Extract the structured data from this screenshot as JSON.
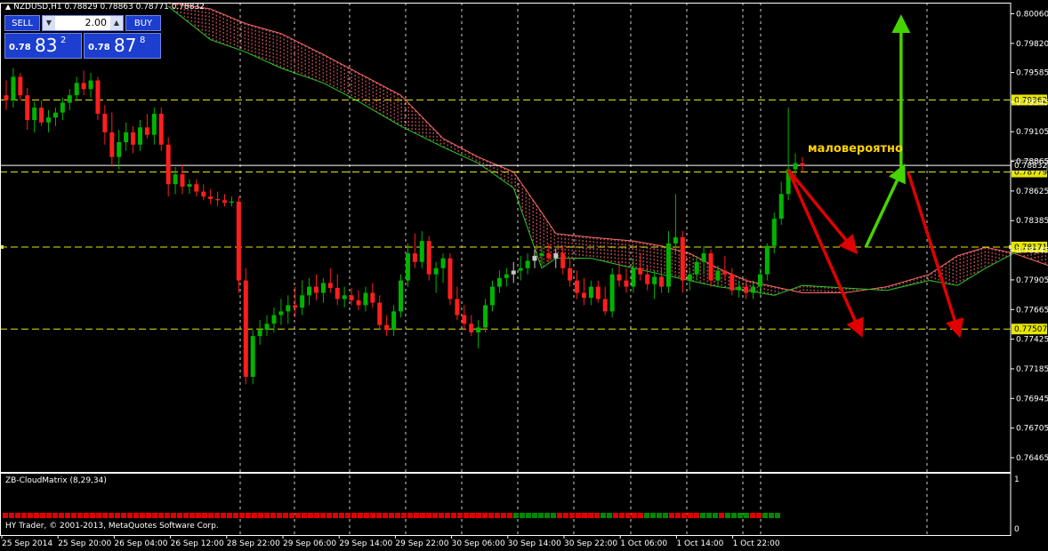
{
  "header": {
    "symbol_label": "NZDUSD,H1",
    "ohlc_text": "0.78829 0.78863 0.78771 0.78832"
  },
  "trade_panel": {
    "sell_label": "SELL",
    "buy_label": "BUY",
    "lot_value": "2.00",
    "sell_quote": {
      "prefix": "0.78",
      "big": "83",
      "sup": "2"
    },
    "buy_quote": {
      "prefix": "0.78",
      "big": "87",
      "sup": "8"
    }
  },
  "annotation_text": "маловероятно",
  "indicator": {
    "label": "ZB-CloudMatrix (8,29,34)",
    "scale_top": "1",
    "scale_bottom": "0"
  },
  "copyright": "HY Trader, © 2001-2013, MetaQuotes Software Corp.",
  "colors": {
    "background": "#000000",
    "bull": "#00b400",
    "bear": "#ff1e1e",
    "neutral": "#c8c8c8",
    "level_line": "#e6e600",
    "cloud_upper": "#ff6a6a",
    "cloud_lower": "#28c828",
    "arrow_red": "#e00000",
    "arrow_green": "#46d400"
  },
  "chart_data": {
    "type": "candlestick",
    "symbol": "NZDUSD",
    "timeframe": "H1",
    "ylim": [
      0.7635,
      0.8015
    ],
    "y_ticks": [
      "0.80060",
      "0.79820",
      "0.79585",
      "0.79345",
      "0.79105",
      "0.78865",
      "0.78625",
      "0.78385",
      "0.78145",
      "0.77905",
      "0.77665",
      "0.77425",
      "0.77185",
      "0.76945",
      "0.76705",
      "0.76465"
    ],
    "x_tick_labels": [
      "25 Sep 2014",
      "25 Sep 20:00",
      "26 Sep 04:00",
      "26 Sep 12:00",
      "28 Sep 22:00",
      "29 Sep 06:00",
      "29 Sep 14:00",
      "29 Sep 22:00",
      "30 Sep 06:00",
      "30 Sep 14:00",
      "30 Sep 22:00",
      "1 Oct 06:00",
      "1 Oct 14:00",
      "1 Oct 22:00"
    ],
    "price_levels": [
      {
        "value": 0.79362,
        "label": "0.79362"
      },
      {
        "value": 0.78779,
        "label": "0.78779"
      },
      {
        "value": 0.78171,
        "label": "0.78171"
      },
      {
        "value": 0.77507,
        "label": "0.77507"
      }
    ],
    "bid_line": {
      "value": 0.78832,
      "label": "0.78832"
    },
    "candles": [
      [
        0.794,
        0.7952,
        0.7928,
        0.7936
      ],
      [
        0.7936,
        0.7962,
        0.793,
        0.7955
      ],
      [
        0.7955,
        0.7958,
        0.7936,
        0.794
      ],
      [
        0.794,
        0.7946,
        0.7912,
        0.792
      ],
      [
        0.792,
        0.7935,
        0.791,
        0.793
      ],
      [
        0.793,
        0.7936,
        0.7915,
        0.7918
      ],
      [
        0.7918,
        0.7928,
        0.791,
        0.7922
      ],
      [
        0.7922,
        0.793,
        0.7915,
        0.7926
      ],
      [
        0.7926,
        0.7938,
        0.792,
        0.7934
      ],
      [
        0.7934,
        0.7945,
        0.7928,
        0.794
      ],
      [
        0.794,
        0.7955,
        0.7935,
        0.795
      ],
      [
        0.795,
        0.796,
        0.794,
        0.7945
      ],
      [
        0.7945,
        0.7958,
        0.7938,
        0.7952
      ],
      [
        0.7952,
        0.7955,
        0.792,
        0.7925
      ],
      [
        0.7925,
        0.7932,
        0.79,
        0.791
      ],
      [
        0.791,
        0.7926,
        0.7882,
        0.789
      ],
      [
        0.789,
        0.7912,
        0.788,
        0.7902
      ],
      [
        0.7902,
        0.7918,
        0.7895,
        0.791
      ],
      [
        0.791,
        0.7915,
        0.7893,
        0.79
      ],
      [
        0.79,
        0.792,
        0.7895,
        0.7914
      ],
      [
        0.7914,
        0.7925,
        0.7905,
        0.7908
      ],
      [
        0.7908,
        0.793,
        0.79,
        0.7925
      ],
      [
        0.7925,
        0.793,
        0.7895,
        0.79
      ],
      [
        0.79,
        0.7906,
        0.7858,
        0.7868
      ],
      [
        0.7868,
        0.7882,
        0.786,
        0.7876
      ],
      [
        0.7876,
        0.7884,
        0.786,
        0.7866
      ],
      [
        0.7866,
        0.7872,
        0.786,
        0.7868
      ],
      [
        0.7868,
        0.7872,
        0.7858,
        0.7862
      ],
      [
        0.7862,
        0.7868,
        0.7855,
        0.7858
      ],
      [
        0.7858,
        0.7864,
        0.7852,
        0.7856
      ],
      [
        0.7856,
        0.7862,
        0.785,
        0.7855
      ],
      [
        0.7855,
        0.786,
        0.785,
        0.7853
      ],
      [
        0.7853,
        0.7858,
        0.785,
        0.7854
      ],
      [
        0.7854,
        0.7858,
        0.778,
        0.779
      ],
      [
        0.779,
        0.78,
        0.7706,
        0.7712
      ],
      [
        0.7712,
        0.775,
        0.7706,
        0.7745
      ],
      [
        0.7745,
        0.7758,
        0.7738,
        0.775
      ],
      [
        0.775,
        0.7762,
        0.7745,
        0.7755
      ],
      [
        0.7755,
        0.7768,
        0.7748,
        0.7762
      ],
      [
        0.7762,
        0.7775,
        0.7754,
        0.7765
      ],
      [
        0.7765,
        0.7778,
        0.7755,
        0.777
      ],
      [
        0.777,
        0.7785,
        0.776,
        0.7768
      ],
      [
        0.7768,
        0.779,
        0.7762,
        0.7778
      ],
      [
        0.7778,
        0.7792,
        0.777,
        0.7785
      ],
      [
        0.7785,
        0.7795,
        0.7774,
        0.778
      ],
      [
        0.778,
        0.7792,
        0.7772,
        0.7788
      ],
      [
        0.7788,
        0.78,
        0.778,
        0.7784
      ],
      [
        0.7784,
        0.7795,
        0.777,
        0.7775
      ],
      [
        0.7775,
        0.7785,
        0.7768,
        0.7778
      ],
      [
        0.7778,
        0.7784,
        0.777,
        0.7774
      ],
      [
        0.7774,
        0.7782,
        0.7766,
        0.777
      ],
      [
        0.777,
        0.7785,
        0.7765,
        0.778
      ],
      [
        0.778,
        0.7788,
        0.7768,
        0.7772
      ],
      [
        0.7772,
        0.7778,
        0.775,
        0.7754
      ],
      [
        0.7754,
        0.7762,
        0.7745,
        0.775
      ],
      [
        0.775,
        0.777,
        0.7745,
        0.7765
      ],
      [
        0.7765,
        0.7795,
        0.776,
        0.779
      ],
      [
        0.779,
        0.782,
        0.7785,
        0.7812
      ],
      [
        0.7812,
        0.7828,
        0.78,
        0.7805
      ],
      [
        0.7805,
        0.783,
        0.78,
        0.7822
      ],
      [
        0.7822,
        0.7826,
        0.779,
        0.7795
      ],
      [
        0.7795,
        0.7805,
        0.778,
        0.78
      ],
      [
        0.78,
        0.7812,
        0.7788,
        0.7808
      ],
      [
        0.7808,
        0.7812,
        0.777,
        0.7775
      ],
      [
        0.7775,
        0.7785,
        0.7758,
        0.7762
      ],
      [
        0.7762,
        0.777,
        0.775,
        0.7755
      ],
      [
        0.7755,
        0.7762,
        0.7745,
        0.7748
      ],
      [
        0.7748,
        0.7758,
        0.7735,
        0.7752
      ],
      [
        0.7752,
        0.7775,
        0.7748,
        0.777
      ],
      [
        0.777,
        0.779,
        0.7765,
        0.7785
      ],
      [
        0.7785,
        0.7798,
        0.778,
        0.7792
      ],
      [
        0.7792,
        0.78,
        0.7785,
        0.7795
      ],
      [
        0.7795,
        0.7805,
        0.7788,
        0.7798
      ],
      [
        0.7798,
        0.781,
        0.779,
        0.78
      ],
      [
        0.78,
        0.7812,
        0.7795,
        0.7806
      ],
      [
        0.7806,
        0.7815,
        0.78,
        0.781
      ],
      [
        0.781,
        0.7818,
        0.7802,
        0.7812
      ],
      [
        0.7812,
        0.782,
        0.7805,
        0.7808
      ],
      [
        0.7808,
        0.7816,
        0.78,
        0.7812
      ],
      [
        0.7812,
        0.7818,
        0.7795,
        0.78
      ],
      [
        0.78,
        0.7808,
        0.7785,
        0.779
      ],
      [
        0.779,
        0.7798,
        0.7775,
        0.778
      ],
      [
        0.778,
        0.7792,
        0.777,
        0.7776
      ],
      [
        0.7776,
        0.779,
        0.777,
        0.7785
      ],
      [
        0.7785,
        0.779,
        0.7772,
        0.7775
      ],
      [
        0.7775,
        0.7785,
        0.7762,
        0.7765
      ],
      [
        0.7765,
        0.78,
        0.776,
        0.7795
      ],
      [
        0.7795,
        0.7805,
        0.7785,
        0.779
      ],
      [
        0.779,
        0.78,
        0.778,
        0.7785
      ],
      [
        0.7785,
        0.7808,
        0.778,
        0.78
      ],
      [
        0.78,
        0.7812,
        0.779,
        0.7795
      ],
      [
        0.7795,
        0.7802,
        0.7782,
        0.7787
      ],
      [
        0.7787,
        0.7798,
        0.7775,
        0.7793
      ],
      [
        0.7793,
        0.78,
        0.778,
        0.7785
      ],
      [
        0.7785,
        0.783,
        0.778,
        0.782
      ],
      [
        0.782,
        0.786,
        0.7812,
        0.7825
      ],
      [
        0.7825,
        0.783,
        0.778,
        0.779
      ],
      [
        0.779,
        0.78,
        0.7782,
        0.7795
      ],
      [
        0.7795,
        0.781,
        0.779,
        0.7805
      ],
      [
        0.7805,
        0.7818,
        0.7795,
        0.7812
      ],
      [
        0.7812,
        0.7815,
        0.7785,
        0.779
      ],
      [
        0.779,
        0.7802,
        0.7785,
        0.7798
      ],
      [
        0.7798,
        0.781,
        0.779,
        0.7795
      ],
      [
        0.7795,
        0.78,
        0.7778,
        0.7782
      ],
      [
        0.7782,
        0.779,
        0.7776,
        0.7785
      ],
      [
        0.7785,
        0.7792,
        0.7775,
        0.778
      ],
      [
        0.778,
        0.779,
        0.7775,
        0.7785
      ],
      [
        0.7785,
        0.78,
        0.7778,
        0.7795
      ],
      [
        0.7795,
        0.782,
        0.779,
        0.7818
      ],
      [
        0.7818,
        0.7845,
        0.7812,
        0.784
      ],
      [
        0.784,
        0.787,
        0.7835,
        0.786
      ],
      [
        0.786,
        0.793,
        0.7855,
        0.788
      ],
      [
        0.788,
        0.7893,
        0.787,
        0.7885
      ],
      [
        0.7885,
        0.789,
        0.7878,
        0.7883
      ]
    ],
    "cloud_upper": [
      [
        0,
        0.8015
      ],
      [
        6,
        0.801
      ],
      [
        11,
        0.7998
      ],
      [
        16,
        0.799
      ],
      [
        22,
        0.7973
      ],
      [
        27,
        0.7958
      ],
      [
        33,
        0.794
      ],
      [
        39,
        0.7905
      ],
      [
        44,
        0.789
      ],
      [
        49,
        0.7878
      ],
      [
        53,
        0.7845
      ],
      [
        55,
        0.7828
      ],
      [
        60,
        0.7825
      ],
      [
        66,
        0.7822
      ],
      [
        70,
        0.7818
      ],
      [
        74,
        0.7812
      ],
      [
        78,
        0.78
      ],
      [
        82,
        0.779
      ],
      [
        86,
        0.7785
      ],
      [
        90,
        0.778
      ],
      [
        96,
        0.778
      ],
      [
        102,
        0.7785
      ],
      [
        108,
        0.7795
      ],
      [
        112,
        0.781
      ],
      [
        116,
        0.7817
      ],
      [
        120,
        0.7812
      ],
      [
        126,
        0.78
      ],
      [
        131,
        0.781
      ],
      [
        134,
        0.784
      ]
    ],
    "cloud_lower": [
      [
        0,
        0.8012
      ],
      [
        6,
        0.7985
      ],
      [
        11,
        0.7975
      ],
      [
        16,
        0.7962
      ],
      [
        22,
        0.795
      ],
      [
        27,
        0.7935
      ],
      [
        33,
        0.7915
      ],
      [
        39,
        0.7898
      ],
      [
        44,
        0.7885
      ],
      [
        49,
        0.7865
      ],
      [
        53,
        0.78
      ],
      [
        55,
        0.7808
      ],
      [
        60,
        0.7808
      ],
      [
        66,
        0.78
      ],
      [
        70,
        0.7795
      ],
      [
        74,
        0.779
      ],
      [
        78,
        0.7785
      ],
      [
        82,
        0.7782
      ],
      [
        86,
        0.7778
      ],
      [
        90,
        0.7786
      ],
      [
        96,
        0.7784
      ],
      [
        102,
        0.7782
      ],
      [
        108,
        0.779
      ],
      [
        112,
        0.7786
      ],
      [
        116,
        0.78
      ],
      [
        120,
        0.7812
      ],
      [
        126,
        0.7818
      ],
      [
        131,
        0.7812
      ],
      [
        134,
        0.7838
      ]
    ],
    "cloud_start_index": 23,
    "arrows": [
      {
        "color": "red",
        "from": [
          111,
          0.78795
        ],
        "to": [
          120,
          0.78171
        ]
      },
      {
        "color": "red",
        "from": [
          111,
          0.78795
        ],
        "to": [
          121,
          0.77507
        ]
      },
      {
        "color": "green",
        "from": [
          122,
          0.78171
        ],
        "to": [
          127,
          0.78779
        ]
      },
      {
        "color": "green",
        "from": [
          127,
          0.788
        ],
        "to": [
          127,
          0.7998
        ]
      },
      {
        "color": "red",
        "from": [
          128,
          0.78779
        ],
        "to": [
          135,
          0.77507
        ]
      }
    ],
    "indicator_states": "rrrrrrrrrrrrrrrrrrrrrrrrrrrrrrrrrrrrrrrrrrrrrrrrrrrrrrrrrrrrrrrrrrrrrrrrrrrrrrrrrrgggggggrrrrrrrggrrrrrggggrrrrrgggrggggrrggg"
  }
}
